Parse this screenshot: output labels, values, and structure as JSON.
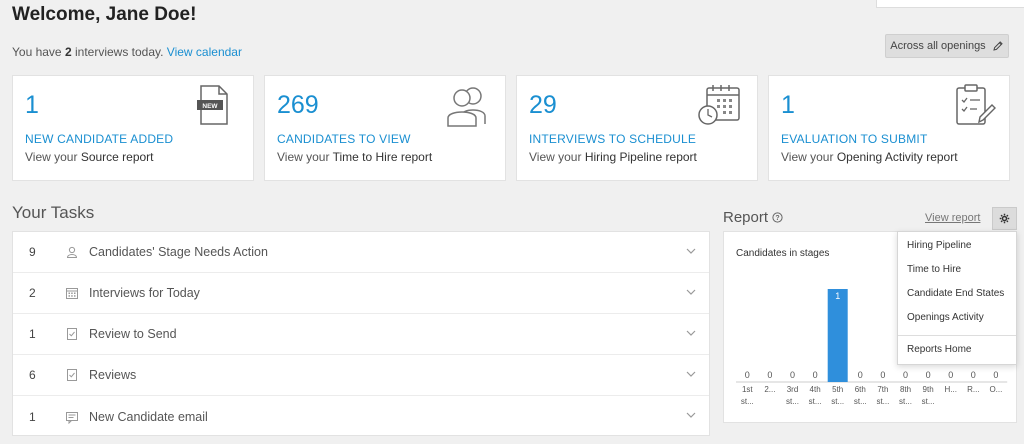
{
  "header": {
    "welcome": "Welcome, Jane Doe!",
    "sub_prefix": "You have ",
    "sub_count": "2",
    "sub_suffix": " interviews today. ",
    "view_calendar": "View calendar",
    "across_label": "Across all openings"
  },
  "cards": [
    {
      "value": "1",
      "label": "NEW CANDIDATE ADDED",
      "desc_prefix": "View your ",
      "desc_report": "Source report",
      "icon": "new-document-icon"
    },
    {
      "value": "269",
      "label": "CANDIDATES TO VIEW",
      "desc_prefix": "View your ",
      "desc_report": "Time to Hire report",
      "icon": "people-icon"
    },
    {
      "value": "29",
      "label": "INTERVIEWS TO SCHEDULE",
      "desc_prefix": "View your ",
      "desc_report": "Hiring Pipeline report",
      "icon": "calendar-clock-icon"
    },
    {
      "value": "1",
      "label": "EVALUATION TO SUBMIT",
      "desc_prefix": "View your ",
      "desc_report": "Opening Activity report",
      "icon": "clipboard-pen-icon"
    }
  ],
  "tasks": {
    "title": "Your Tasks",
    "items": [
      {
        "count": "9",
        "label": "Candidates' Stage Needs Action",
        "icon": "person-icon"
      },
      {
        "count": "2",
        "label": "Interviews for Today",
        "icon": "calendar-icon"
      },
      {
        "count": "1",
        "label": "Review to Send",
        "icon": "checklist-icon"
      },
      {
        "count": "6",
        "label": "Reviews",
        "icon": "checklist-icon"
      },
      {
        "count": "1",
        "label": "New Candidate email",
        "icon": "message-icon"
      }
    ]
  },
  "report": {
    "title": "Report",
    "view_report": "View report",
    "menu": [
      "Hiring Pipeline",
      "Time to Hire",
      "Candidate End States",
      "Openings Activity",
      "Reports Home"
    ]
  },
  "colors": {
    "accent": "#1a8fd1",
    "bar": "#2f8fdc"
  },
  "chart_data": {
    "type": "bar",
    "title": "Candidates in stages",
    "categories": [
      "1st st...",
      "2...",
      "3rd st...",
      "4th st...",
      "5th st...",
      "6th st...",
      "7th st...",
      "8th st...",
      "9th st...",
      "H...",
      "R...",
      "O..."
    ],
    "tick_lines": [
      [
        "1st",
        "st..."
      ],
      [
        "2...",
        ""
      ],
      [
        "3rd",
        "st..."
      ],
      [
        "4th",
        "st..."
      ],
      [
        "5th",
        "st..."
      ],
      [
        "6th",
        "st..."
      ],
      [
        "7th",
        "st..."
      ],
      [
        "8th",
        "st..."
      ],
      [
        "9th",
        "st..."
      ],
      [
        "H...",
        ""
      ],
      [
        "R...",
        ""
      ],
      [
        "O...",
        ""
      ]
    ],
    "values": [
      0,
      0,
      0,
      0,
      1,
      0,
      0,
      0,
      0,
      0,
      0,
      0
    ],
    "ylim": [
      0,
      1
    ]
  }
}
